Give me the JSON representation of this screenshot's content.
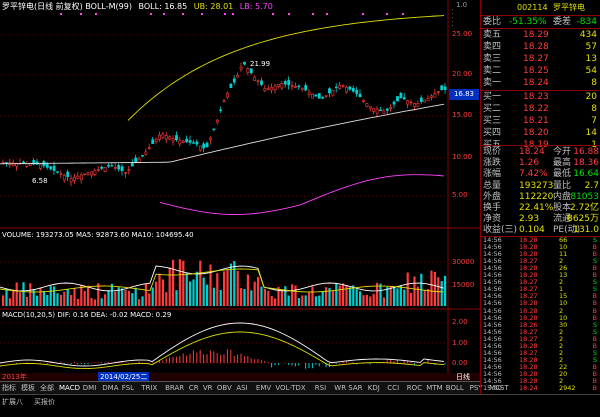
{
  "header": {
    "title": "罗平锌电(日线 前复权) BOLL-M(99)",
    "boll_label": "BOLL: 16.85",
    "ub_label": "UB: 28.01",
    "lb_label": "LB: 5.70"
  },
  "price_axis": {
    "labels": [
      "25.00",
      "20.00",
      "15.00",
      "10.00",
      "5.00"
    ],
    "current_price_tag": "16.83",
    "top_label": "1.0"
  },
  "chart_annotations": {
    "high_label": "21.99",
    "low_label": "6.58"
  },
  "volume_panel": {
    "label": "VOLUME: 193273.05  MA5: 92873.60  MA10: 104695.40",
    "axis_labels": [
      "30000",
      "15000"
    ]
  },
  "macd_panel": {
    "label": "MACD(10,20,5)  DIF: 0.16  DEA: -0.02  MACD: 0.29",
    "axis_labels": [
      "2.00",
      "1.00",
      "0.00"
    ]
  },
  "timeline": {
    "start_label": "2013年",
    "date_label": "2014/02/25二",
    "period_label": "日线"
  },
  "indicator_tabs": [
    "指标",
    "模板",
    "全部",
    "MACD",
    "DMI",
    "DMA",
    "FSL",
    "TRIX",
    "BRAR",
    "CR",
    "VR",
    "OBV",
    "ASI",
    "EMV",
    "VOL-TDX",
    "RSI",
    "WR",
    "SAR",
    "KDJ",
    "CCI",
    "ROC",
    "MTM",
    "BOLL",
    "PSY",
    "MCST"
  ],
  "status_bar": {
    "item1": "扩展八",
    "item2": "买报价"
  },
  "quote": {
    "code": "002114",
    "name": "罗平锌电",
    "weibi_label": "委比",
    "weibi_value": "-51.35%",
    "weicha_label": "委差",
    "weicha_value": "-834",
    "asks": [
      {
        "label": "卖五",
        "price": "18.29",
        "qty": "434"
      },
      {
        "label": "卖四",
        "price": "18.28",
        "qty": "57"
      },
      {
        "label": "卖三",
        "price": "18.27",
        "qty": "13"
      },
      {
        "label": "卖二",
        "price": "18.25",
        "qty": "54"
      },
      {
        "label": "卖一",
        "price": "18.24",
        "qty": "8"
      }
    ],
    "bids": [
      {
        "label": "买一",
        "price": "18.23",
        "qty": "20"
      },
      {
        "label": "买二",
        "price": "18.22",
        "qty": "8"
      },
      {
        "label": "买三",
        "price": "18.21",
        "qty": "7"
      },
      {
        "label": "买四",
        "price": "18.20",
        "qty": "14"
      },
      {
        "label": "买五",
        "price": "18.19",
        "qty": "1"
      }
    ],
    "stats": [
      {
        "l1": "现价",
        "v1": "18.24",
        "l2": "今开",
        "v2": "16.88"
      },
      {
        "l1": "涨跌",
        "v1": "1.26",
        "l2": "最高",
        "v2": "18.36"
      },
      {
        "l1": "涨幅",
        "v1": "7.42%",
        "l2": "最低",
        "v2": "16.64"
      },
      {
        "l1": "总量",
        "v1": "193273",
        "l2": "量比",
        "v2": "2.7"
      },
      {
        "l1": "外盘",
        "v1": "112220",
        "l2": "内盘",
        "v2": "81053"
      },
      {
        "l1": "换手",
        "v1": "22.41%",
        "l2": "股本",
        "v2": "2.72亿"
      },
      {
        "l1": "净资",
        "v1": "2.93",
        "l2": "流通",
        "v2": "8625万"
      },
      {
        "l1": "收益(三)",
        "v1": "0.104",
        "l2": "PE(动)",
        "v2": "131.0"
      }
    ],
    "ticks": [
      {
        "time": "14:56",
        "price": "18.28",
        "vol": "66",
        "side": "S"
      },
      {
        "time": "14:56",
        "price": "18.28",
        "vol": "10",
        "side": "B"
      },
      {
        "time": "14:56",
        "price": "18.28",
        "vol": "11",
        "side": "B"
      },
      {
        "time": "14:56",
        "price": "18.27",
        "vol": "2",
        "side": "S"
      },
      {
        "time": "14:56",
        "price": "18.28",
        "vol": "26",
        "side": "B"
      },
      {
        "time": "14:56",
        "price": "18.28",
        "vol": "13",
        "side": "B"
      },
      {
        "time": "14:56",
        "price": "18.27",
        "vol": "2",
        "side": "S"
      },
      {
        "time": "14:56",
        "price": "18.27",
        "vol": "1",
        "side": "S"
      },
      {
        "time": "14:56",
        "price": "18.27",
        "vol": "15",
        "side": "B"
      },
      {
        "time": "14:56",
        "price": "18.28",
        "vol": "10",
        "side": "B"
      },
      {
        "time": "14:56",
        "price": "18.28",
        "vol": "2",
        "side": "B"
      },
      {
        "time": "14:56",
        "price": "18.28",
        "vol": "10",
        "side": "B"
      },
      {
        "time": "14:56",
        "price": "18.26",
        "vol": "30",
        "side": "S"
      },
      {
        "time": "14:56",
        "price": "18.27",
        "vol": "2",
        "side": "S"
      },
      {
        "time": "14:56",
        "price": "18.27",
        "vol": "2",
        "side": "B"
      },
      {
        "time": "14:56",
        "price": "18.28",
        "vol": "2",
        "side": "B"
      },
      {
        "time": "14:56",
        "price": "18.27",
        "vol": "2",
        "side": "S"
      },
      {
        "time": "14:56",
        "price": "18.28",
        "vol": "2",
        "side": "S"
      },
      {
        "time": "14:56",
        "price": "18.28",
        "vol": "22",
        "side": "B"
      },
      {
        "time": "14:56",
        "price": "18.28",
        "vol": "20",
        "side": "B"
      },
      {
        "time": "14:56",
        "price": "18.28",
        "vol": "2",
        "side": "B"
      },
      {
        "time": "15:00",
        "price": "18.24",
        "vol": "2942",
        "side": "B"
      }
    ]
  },
  "colors": {
    "up": "#ff3b3b",
    "down": "#00d0d0",
    "boll_upper": "#e0e000",
    "boll_mid": "#e0e0e0",
    "boll_lower": "#ff40ff",
    "panel_border": "#8a0000"
  }
}
